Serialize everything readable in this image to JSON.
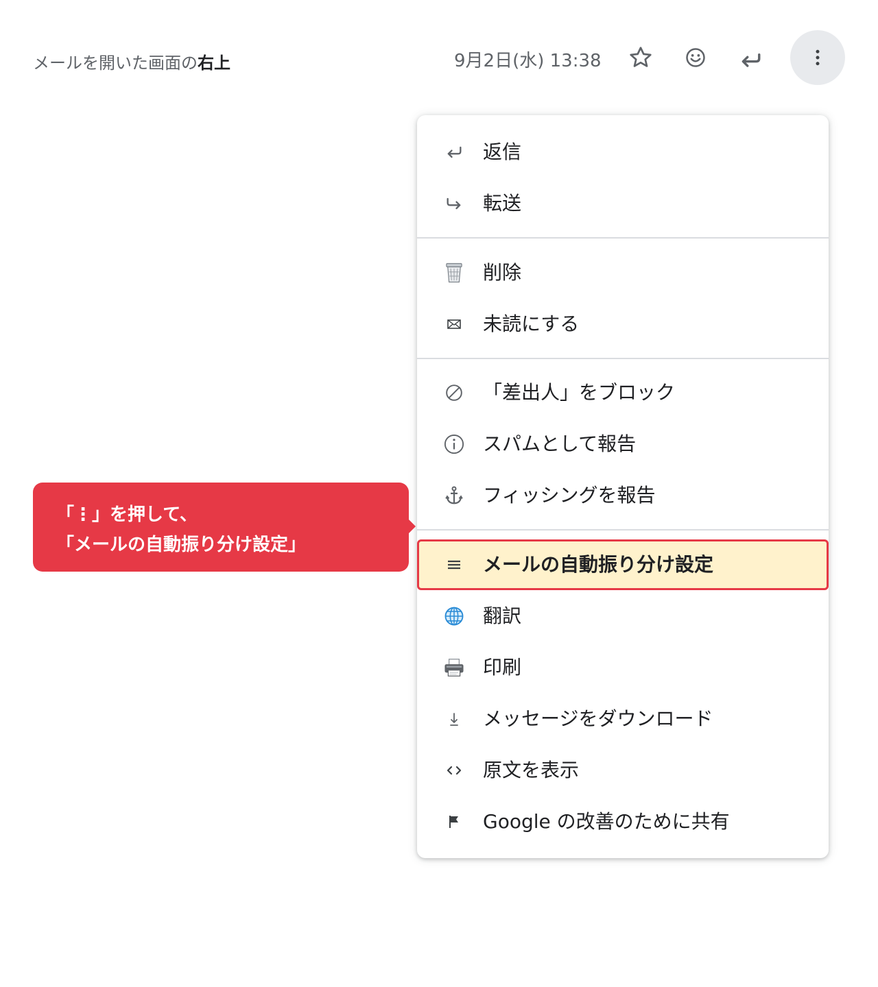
{
  "caption": {
    "prefix": "メールを開いた画面の",
    "bold": "右上"
  },
  "header": {
    "date": "9月2日(水) 13:38",
    "star_icon": "star-outline-icon",
    "emoji_icon": "emoji-smile-icon",
    "reply_icon": "reply-icon",
    "more_icon": "more-vertical-icon"
  },
  "menu": {
    "items": [
      {
        "label": "返信",
        "icon": "reply-icon"
      },
      {
        "label": "転送",
        "icon": "forward-icon"
      },
      {
        "label": "削除",
        "icon": "trash-icon"
      },
      {
        "label": "未読にする",
        "icon": "envelope-icon"
      },
      {
        "label": "「差出人」をブロック",
        "icon": "block-icon"
      },
      {
        "label": "スパムとして報告",
        "icon": "info-icon"
      },
      {
        "label": "フィッシングを報告",
        "icon": "anchor-icon"
      },
      {
        "label": "メールの自動振り分け設定",
        "icon": "filter-lines-icon",
        "highlighted": true
      },
      {
        "label": "翻訳",
        "icon": "globe-icon"
      },
      {
        "label": "印刷",
        "icon": "printer-icon"
      },
      {
        "label": "メッセージをダウンロード",
        "icon": "download-icon"
      },
      {
        "label": "原文を表示",
        "icon": "code-icon"
      },
      {
        "label": "Google の改善のために共有",
        "icon": "flag-icon"
      }
    ]
  },
  "callout": {
    "line1": "「⋮」を押して、",
    "line2": "「メールの自動振り分け設定」"
  },
  "colors": {
    "accent_red": "#e63946",
    "highlight_bg": "#fff2cc",
    "more_button_bg": "#e8eaed",
    "icon_gray": "#5f6368"
  }
}
